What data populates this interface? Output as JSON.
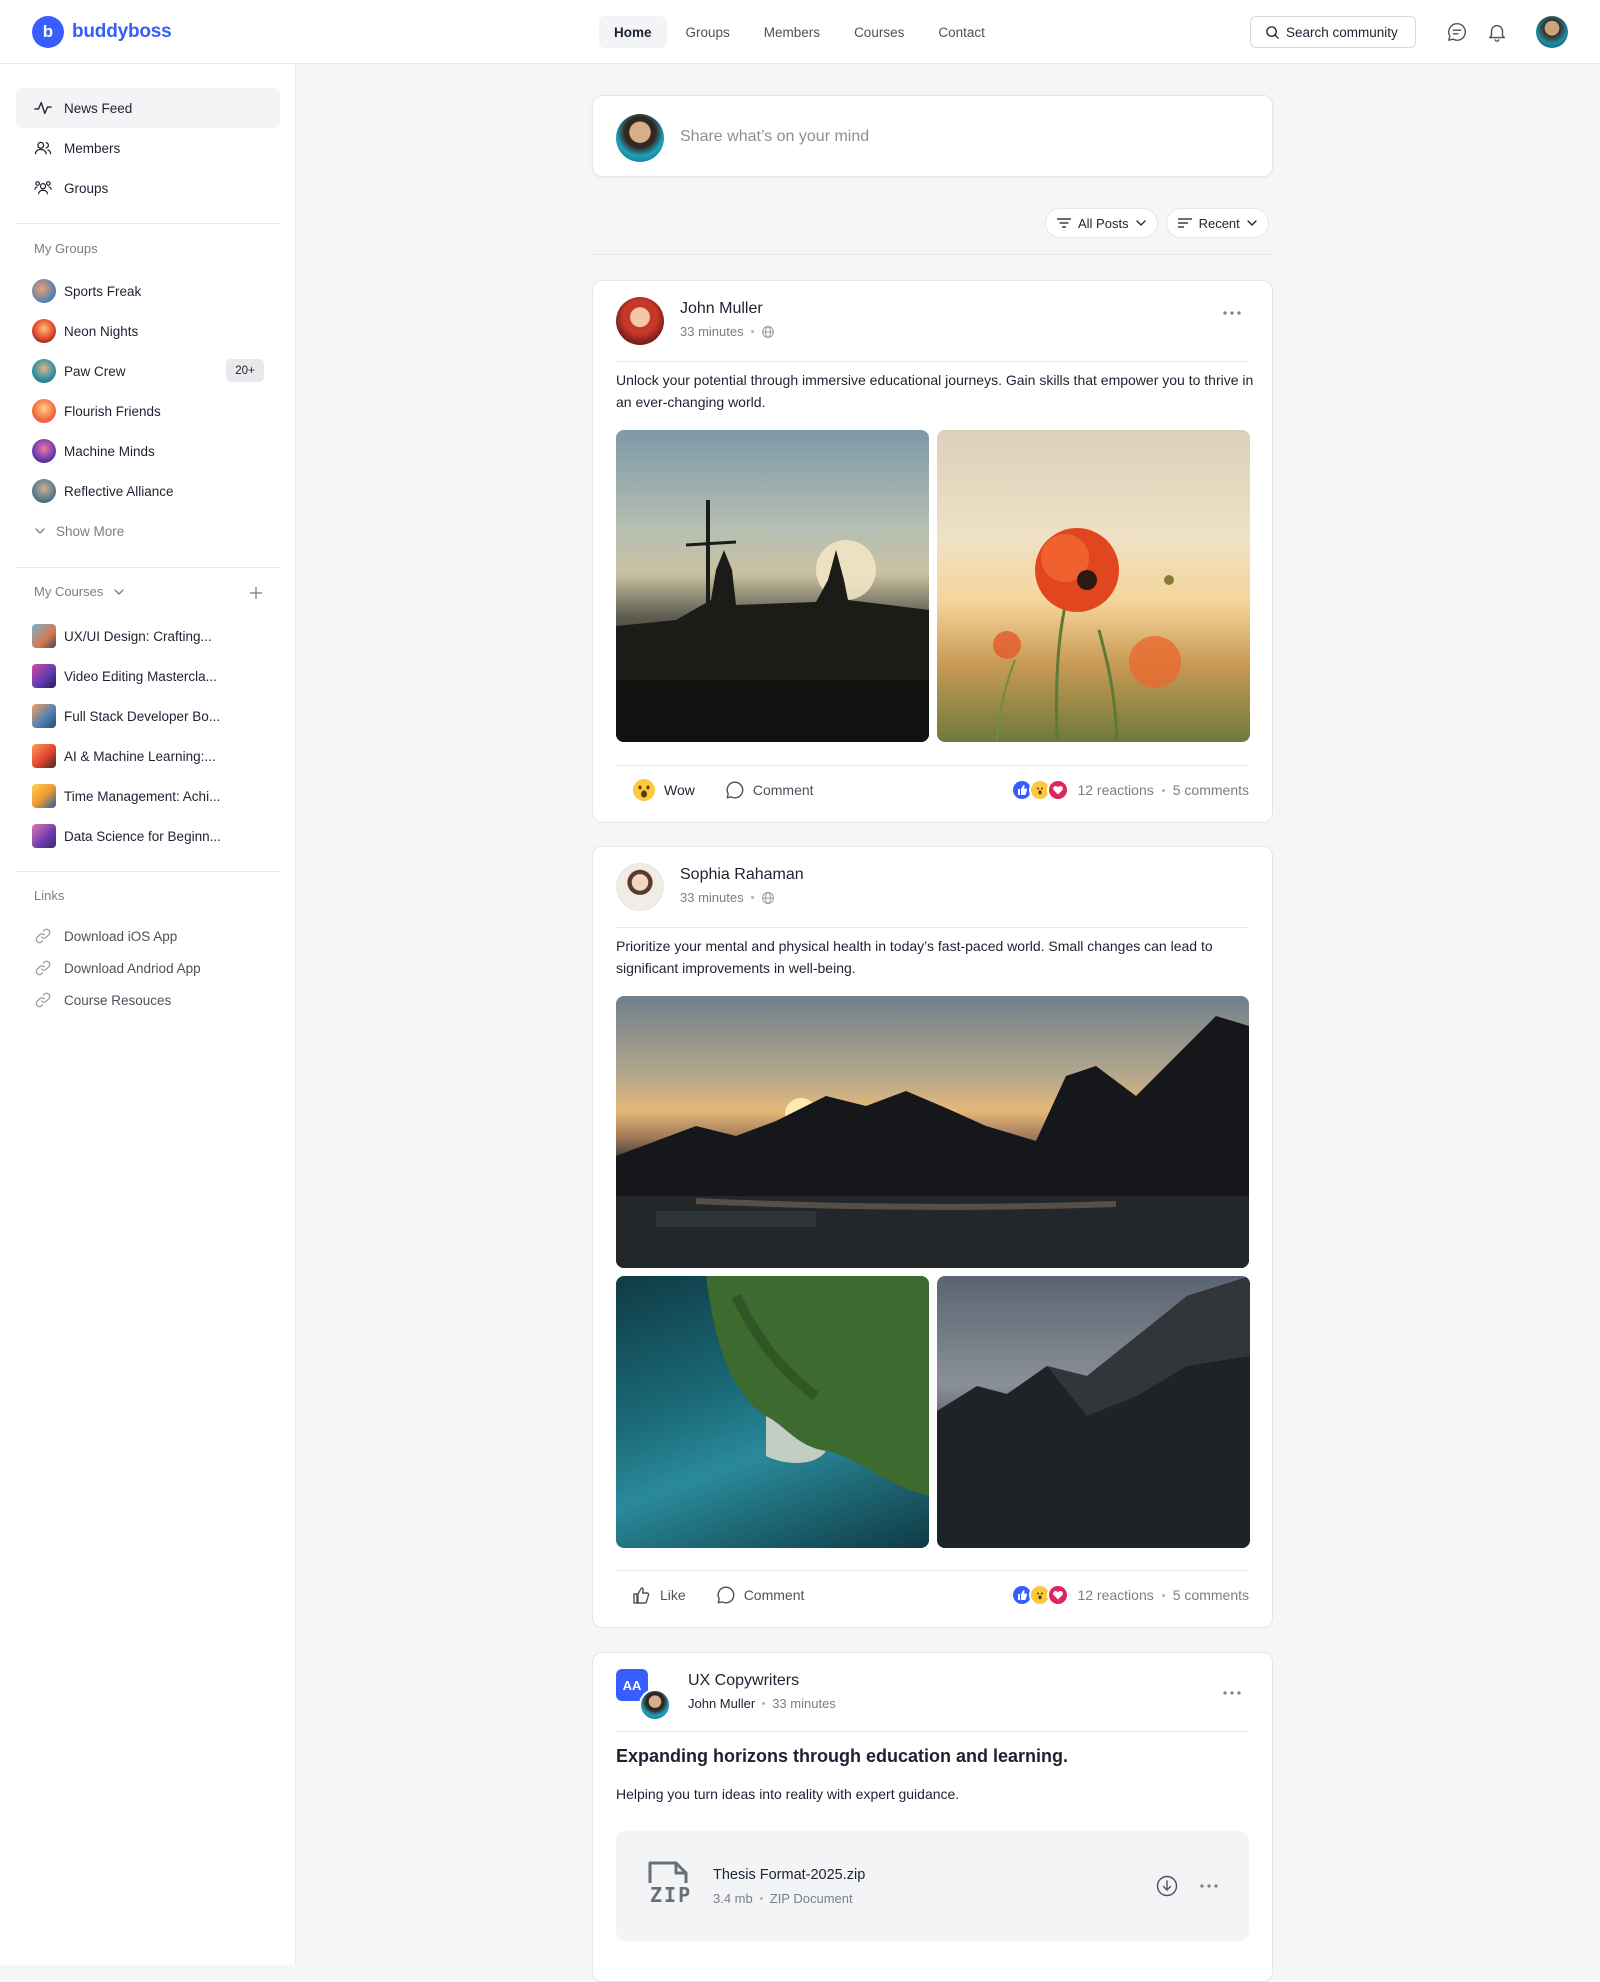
{
  "brand": {
    "name": "buddyboss",
    "color": "#385dff"
  },
  "nav": {
    "items": [
      {
        "label": "Home",
        "active": true
      },
      {
        "label": "Groups",
        "active": false
      },
      {
        "label": "Members",
        "active": false
      },
      {
        "label": "Courses",
        "active": false
      },
      {
        "label": "Contact",
        "active": false
      }
    ],
    "search_label": "Search community"
  },
  "sidebar": {
    "main": [
      {
        "label": "News Feed",
        "icon": "activity-icon",
        "active": true
      },
      {
        "label": "Members",
        "icon": "members-icon",
        "active": false
      },
      {
        "label": "Groups",
        "icon": "groups-icon",
        "active": false
      }
    ],
    "my_groups": {
      "heading": "My Groups",
      "items": [
        {
          "label": "Sports Freak"
        },
        {
          "label": "Neon Nights"
        },
        {
          "label": "Paw Crew",
          "badge": "20+"
        },
        {
          "label": "Flourish Friends"
        },
        {
          "label": "Machine Minds"
        },
        {
          "label": "Reflective Alliance"
        }
      ],
      "show_more": "Show More"
    },
    "my_courses": {
      "heading": "My Courses",
      "items": [
        {
          "label": "UX/UI Design: Crafting..."
        },
        {
          "label": "Video Editing Mastercla..."
        },
        {
          "label": "Full Stack Developer Bo..."
        },
        {
          "label": "AI & Machine Learning:..."
        },
        {
          "label": "Time Management: Achi..."
        },
        {
          "label": "Data Science for Beginn..."
        }
      ]
    },
    "links": {
      "heading": "Links",
      "items": [
        {
          "label": "Download iOS App"
        },
        {
          "label": "Download Andriod App"
        },
        {
          "label": "Course Resouces"
        }
      ]
    }
  },
  "composer": {
    "placeholder": "Share what’s on your mind"
  },
  "filters": {
    "all_posts": "All Posts",
    "recent": "Recent"
  },
  "posts": [
    {
      "author": "John Muller",
      "time": "33 minutes",
      "text": "Unlock your potential through immersive educational journeys. Gain skills that empower you to thrive in an ever-changing world.",
      "reaction_label": "Wow",
      "comment_label": "Comment",
      "reactions": "12 reactions",
      "comments": "5 comments"
    },
    {
      "author": "Sophia Rahaman",
      "time": "33 minutes",
      "text": "Prioritize your mental and physical health in today’s fast-paced world. Small changes can lead to significant improvements in well-being.",
      "reaction_label": "Like",
      "comment_label": "Comment",
      "reactions": "12 reactions",
      "comments": "5 comments"
    },
    {
      "group_name": "UX Copywriters",
      "group_initials": "AA",
      "author": "John Muller",
      "time": "33 minutes",
      "title": "Expanding horizons through education and learning.",
      "text": "Helping you turn ideas into reality with expert guidance.",
      "file": {
        "name": "Thesis Format-2025.zip",
        "size": "3.4 mb",
        "type": "ZIP Document",
        "icon_label": "ZIP"
      }
    }
  ]
}
